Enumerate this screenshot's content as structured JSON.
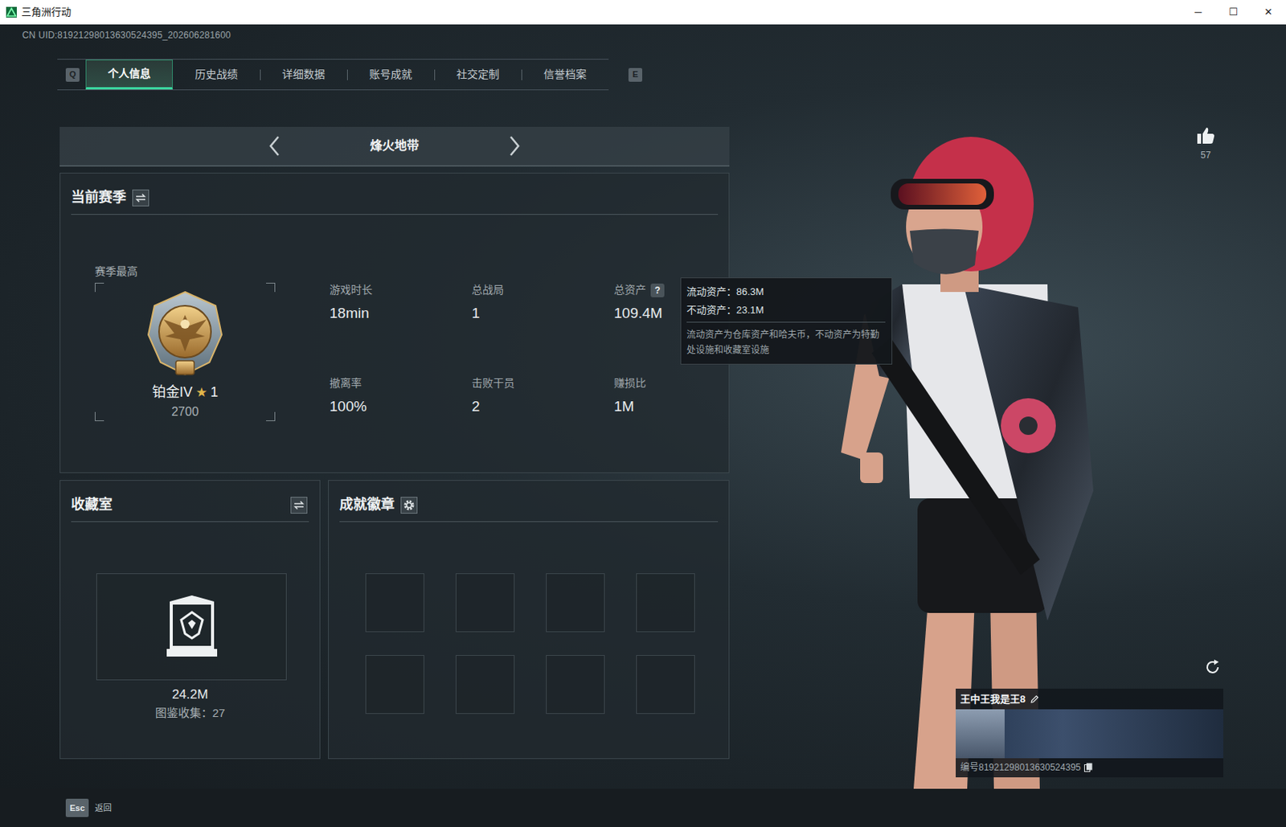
{
  "window": {
    "title": "三角洲行动",
    "controls": [
      "─",
      "☐",
      "✕"
    ]
  },
  "uid": "CN UID:81921298013630524395_202606281600",
  "tabs": {
    "prev_key": "Q",
    "next_key": "E",
    "items": [
      {
        "label": "个人信息",
        "selected": true
      },
      {
        "label": "历史战绩",
        "selected": false
      },
      {
        "label": "详细数据",
        "selected": false
      },
      {
        "label": "账号成就",
        "selected": false
      },
      {
        "label": "社交定制",
        "selected": false
      },
      {
        "label": "信誉档案",
        "selected": false
      }
    ]
  },
  "mode": {
    "title": "烽火地带"
  },
  "season": {
    "title": "当前赛季",
    "best_label": "赛季最高",
    "rank": "铂金IV",
    "star_icon": "★",
    "stars": "1",
    "score": "2700",
    "stats": [
      {
        "label": "游戏时长",
        "value": "18min"
      },
      {
        "label": "总战局",
        "value": "1"
      },
      {
        "label": "总资产",
        "value": "109.4M",
        "help": "?"
      },
      {
        "label": "撤离率",
        "value": "100%"
      },
      {
        "label": "击败干员",
        "value": "2"
      },
      {
        "label": "赚损比",
        "value": "1M"
      }
    ]
  },
  "tooltip": {
    "lines": [
      "流动资产：86.3M",
      "不动资产：23.1M"
    ],
    "note": "流动资产为仓库资产和哈夫币，不动资产为特勤处设施和收藏室设施"
  },
  "collection": {
    "title": "收藏室",
    "value": "24.2M",
    "count": "图鉴收集：27"
  },
  "badges": {
    "title": "成就徽章",
    "slots": [
      {
        "filled": false
      },
      {
        "filled": false
      },
      {
        "filled": false
      },
      {
        "filled": false
      },
      {
        "filled": false
      },
      {
        "filled": false
      },
      {
        "filled": false
      },
      {
        "filled": false
      }
    ]
  },
  "profile": {
    "likes": "57",
    "name": "王中王我是王8",
    "id": "编号81921298013630524395"
  },
  "footer": {
    "key": "Esc",
    "label": "返回"
  }
}
